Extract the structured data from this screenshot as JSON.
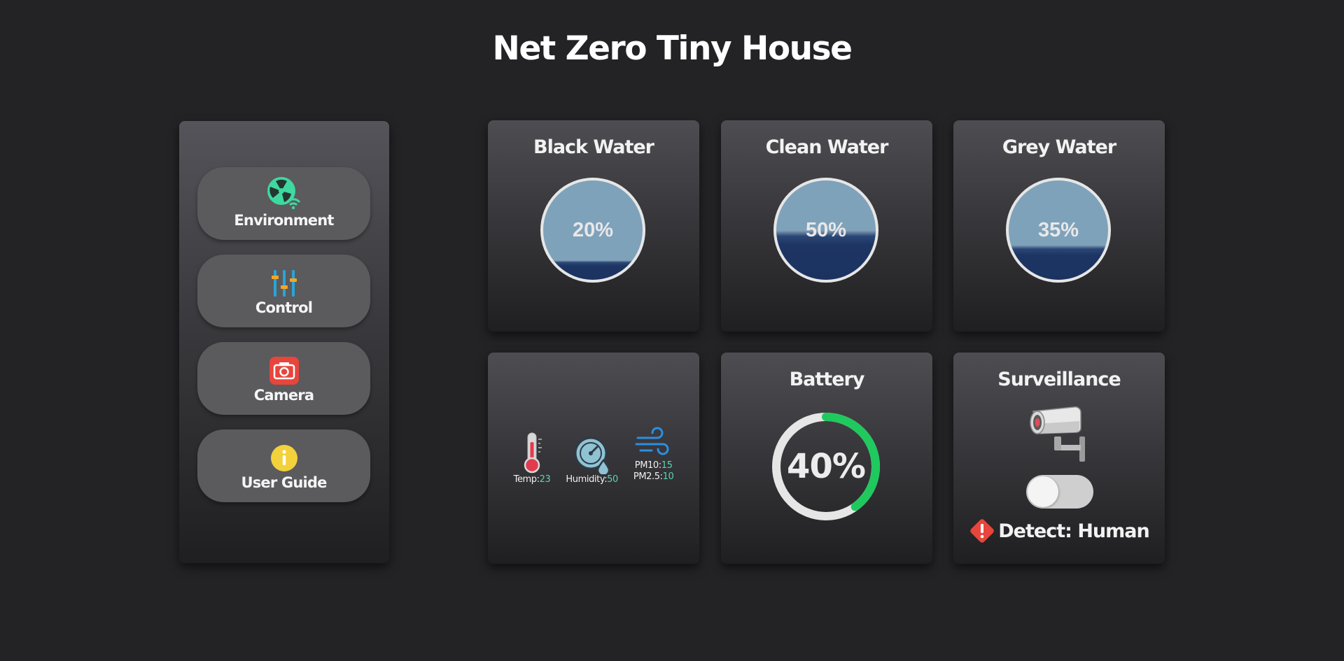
{
  "page": {
    "title": "Net Zero Tiny House"
  },
  "sidebar": {
    "items": [
      {
        "label": "Environment",
        "icon": "fan-wifi-icon"
      },
      {
        "label": "Control",
        "icon": "sliders-icon"
      },
      {
        "label": "Camera",
        "icon": "camera-icon"
      },
      {
        "label": "User Guide",
        "icon": "info-icon"
      }
    ]
  },
  "tanks": {
    "black_water": {
      "title": "Black Water",
      "level": 20,
      "label": "20%"
    },
    "clean_water": {
      "title": "Clean Water",
      "level": 50,
      "label": "50%"
    },
    "grey_water": {
      "title": "Grey Water",
      "level": 35,
      "label": "35%"
    }
  },
  "environment": {
    "temp_label": "Temp:",
    "temp_value": "23",
    "humidity_label": "Humidity:",
    "humidity_value": "50",
    "pm10_label": "PM10:",
    "pm10_value": "15",
    "pm25_label": "PM2.5:",
    "pm25_value": "10"
  },
  "battery": {
    "title": "Battery",
    "level": 40,
    "label": "40%"
  },
  "surveillance": {
    "title": "Surveillance",
    "toggle_on": false,
    "detect_text": "Detect: Human"
  },
  "colors": {
    "background": "#232224",
    "accent_green": "#1fc95e",
    "value_teal": "#57d6b0",
    "water_dark": "#1d3563",
    "water_light": "#7fa2bb",
    "alert_red": "#e8453c"
  }
}
